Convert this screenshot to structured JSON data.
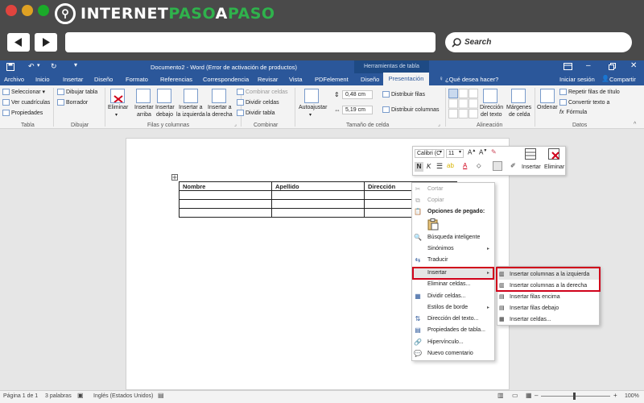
{
  "browser": {
    "logo_text_1": "INTERNET",
    "logo_text_2": "PASO",
    "logo_text_3": "A",
    "logo_text_4": "PASO",
    "search_placeholder": "Search",
    "colors": {
      "dot_red": "#e0443e",
      "dot_yellow": "#dea123",
      "dot_green": "#1aab29",
      "brand_green": "#2fb24c"
    }
  },
  "word": {
    "title": "Documento2 - Word (Error de activación de productos)",
    "context_label": "Herramientas de tabla",
    "tabs": [
      "Archivo",
      "Inicio",
      "Insertar",
      "Diseño",
      "Formato",
      "Referencias",
      "Correspondencia",
      "Revisar",
      "Vista",
      "PDFelement",
      "Diseño",
      "Presentación"
    ],
    "tell_me": "¿Qué desea hacer?",
    "signin": "Iniciar sesión",
    "share": "Compartir",
    "accent": "#2b579a"
  },
  "ribbon": {
    "tabla": {
      "label": "Tabla",
      "seleccionar": "Seleccionar",
      "ver": "Ver cuadrículas",
      "propiedades": "Propiedades"
    },
    "dibujar": {
      "label": "Dibujar",
      "dibujar_tabla": "Dibujar tabla",
      "borrador": "Borrador"
    },
    "filas": {
      "label": "Filas y columnas",
      "eliminar": "Eliminar",
      "ins_arriba_1": "Insertar",
      "ins_arriba_2": "arriba",
      "ins_debajo_1": "Insertar",
      "ins_debajo_2": "debajo",
      "ins_izq_1": "Insertar a",
      "ins_izq_2": "la izquierda",
      "ins_der_1": "Insertar a",
      "ins_der_2": "la derecha"
    },
    "combinar": {
      "label": "Combinar",
      "combinar_celdas": "Combinar celdas",
      "dividir_celdas": "Dividir celdas",
      "dividir_tabla": "Dividir tabla"
    },
    "tamano": {
      "label": "Tamaño de celda",
      "autoajustar": "Autoajustar",
      "alto": "0,48 cm",
      "ancho": "5,19 cm",
      "dist_filas": "Distribuir filas",
      "dist_columnas": "Distribuir columnas"
    },
    "alineacion": {
      "label": "Alineación",
      "direccion_1": "Dirección",
      "direccion_2": "del texto",
      "margenes_1": "Márgenes",
      "margenes_2": "de celda"
    },
    "datos": {
      "label": "Datos",
      "ordenar": "Ordenar",
      "repetir": "Repetir filas de título",
      "convertir": "Convertir texto a",
      "formula": "Fórmula"
    }
  },
  "table": {
    "headers": [
      "Nombre",
      "Apellido",
      "Dirección",
      ""
    ],
    "rows": 4
  },
  "mini_toolbar": {
    "font": "Calibri (C",
    "size": "11",
    "insertar": "Insertar",
    "eliminar": "Eliminar"
  },
  "context_menu": {
    "cortar": "Cortar",
    "copiar": "Copiar",
    "opciones_pegado": "Opciones de pegado:",
    "busqueda": "Búsqueda inteligente",
    "sinonimos": "Sinónimos",
    "traducir": "Traducir",
    "insertar": "Insertar",
    "eliminar_celdas": "Eliminar celdas...",
    "dividir_celdas": "Dividir celdas...",
    "estilos_borde": "Estilos de borde",
    "direccion": "Dirección del texto...",
    "propiedades": "Propiedades de tabla...",
    "hipervinculo": "Hipervínculo...",
    "nuevo_comentario": "Nuevo comentario"
  },
  "submenu": {
    "col_izq": "Insertar columnas a la izquierda",
    "col_der": "Insertar columnas a la derecha",
    "filas_encima": "Insertar filas encima",
    "filas_debajo": "Insertar filas debajo",
    "celdas": "Insertar celdas..."
  },
  "status": {
    "page": "Página 1 de 1",
    "words": "3 palabras",
    "language": "Inglés (Estados Unidos)",
    "zoom": "100%"
  },
  "highlight_color": "#d0021b"
}
